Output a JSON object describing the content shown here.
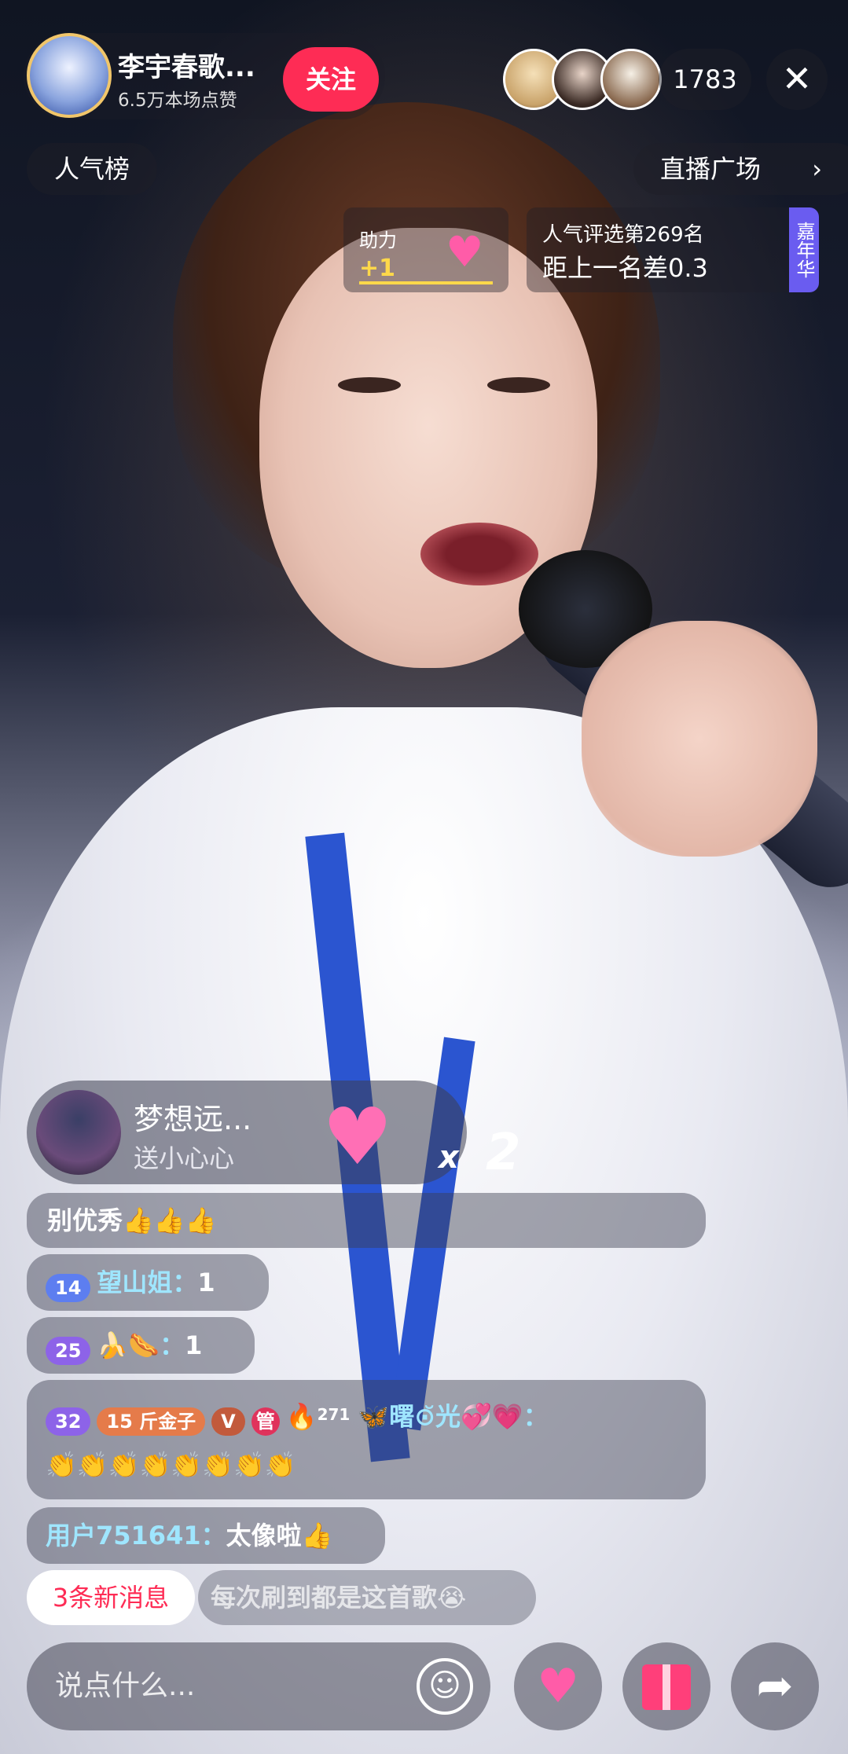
{
  "host": {
    "name": "李宇春歌...",
    "likes": "6.5万本场点赞",
    "follow_label": "关注"
  },
  "viewers": {
    "count": "1783"
  },
  "top_pills": {
    "rank": "人气榜",
    "plaza": "直播广场"
  },
  "assist": {
    "label": "助力",
    "value": "+1"
  },
  "rank_card": {
    "line1": "人气评选第269名",
    "line2": "距上一名差0.3",
    "tag": "嘉年华"
  },
  "gift": {
    "name": "梦想远...",
    "desc": "送小心心",
    "x": "x",
    "count": "2"
  },
  "messages": [
    {
      "text": "别优秀👍👍👍"
    },
    {
      "level": "14",
      "name": "望山姐：",
      "content": "1"
    },
    {
      "level": "25",
      "name": "🍌🌭：",
      "content": "1"
    },
    {
      "level": "32",
      "fan_level": "15",
      "fan_name": "斤金子",
      "v": "V",
      "admin": "管",
      "fire": "🔥",
      "fire_count": "271",
      "name": "🦋曙⊙̆光💞💗：",
      "content": "👏👏👏👏👏👏👏👏"
    },
    {
      "name": "用户751641：",
      "content": "太像啦👍"
    }
  ],
  "new_messages": "3条新消息",
  "faded_message": "每次刷到都是这首歌😭",
  "input": {
    "placeholder": "说点什么..."
  },
  "colors": {
    "accent": "#fe2c55",
    "gold": "#ffd84a",
    "carnival": "#6a5cf0"
  },
  "icons": [
    "close-icon",
    "chevron-right-icon",
    "heart-icon",
    "emoji-icon",
    "gift-icon",
    "share-icon"
  ]
}
